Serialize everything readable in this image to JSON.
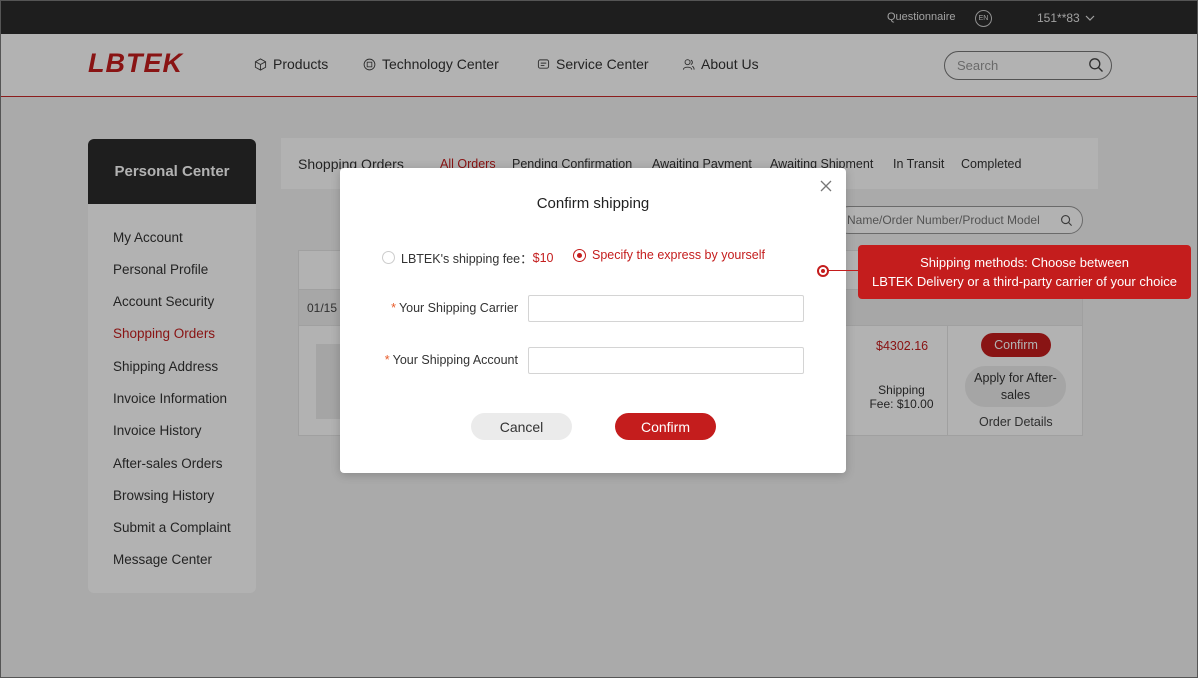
{
  "topbar": {
    "questionnaire": "Questionnaire",
    "lang": "EN",
    "user": "151**83"
  },
  "header": {
    "logo": "LBTEK",
    "nav": [
      {
        "label": "Products",
        "icon": "cube-icon"
      },
      {
        "label": "Technology Center",
        "icon": "chip-icon"
      },
      {
        "label": "Service Center",
        "icon": "message-icon"
      },
      {
        "label": "About Us",
        "icon": "people-icon"
      }
    ],
    "search_placeholder": "Search"
  },
  "sidebar": {
    "title": "Personal Center",
    "items": [
      "My Account",
      "Personal Profile",
      "Account Security",
      "Shopping Orders",
      "Shipping Address",
      "Invoice Information",
      "Invoice History",
      "After-sales Orders",
      "Browsing History",
      "Submit a Complaint",
      "Message Center"
    ],
    "active_index": 3
  },
  "orders": {
    "title": "Shopping Orders",
    "tabs": [
      "All Orders",
      "Pending Confirmation",
      "Awaiting Payment",
      "Awaiting Shipment",
      "In Transit",
      "Completed"
    ],
    "search_placeholder": "Name/Order Number/Product Model",
    "date_partial": "01/15",
    "price": "$4302.16",
    "shipping_fee": "Shipping Fee: $10.00",
    "confirm_label": "Confirm",
    "after_sales_label": "Apply for After-sales",
    "details_label": "Order Details"
  },
  "modal": {
    "title": "Confirm shipping",
    "option_lbtek": "LBTEK's shipping fee：",
    "option_lbtek_fee": "$10",
    "option_self": "Specify the express by yourself",
    "selected_option": "self",
    "carrier_label": "Your Shipping Carrier",
    "carrier_value": "",
    "account_label": "Your Shipping Account",
    "account_value": "",
    "required_mark": "*",
    "cancel_label": "Cancel",
    "confirm_label": "Confirm"
  },
  "annotation": {
    "line1": "Shipping methods: Choose between",
    "line2": "LBTEK Delivery or a third-party carrier of your choice"
  },
  "colors": {
    "brand": "#c41d1d",
    "topbar": "#2c2c2c",
    "sidebar_head": "#2b2b2b"
  }
}
